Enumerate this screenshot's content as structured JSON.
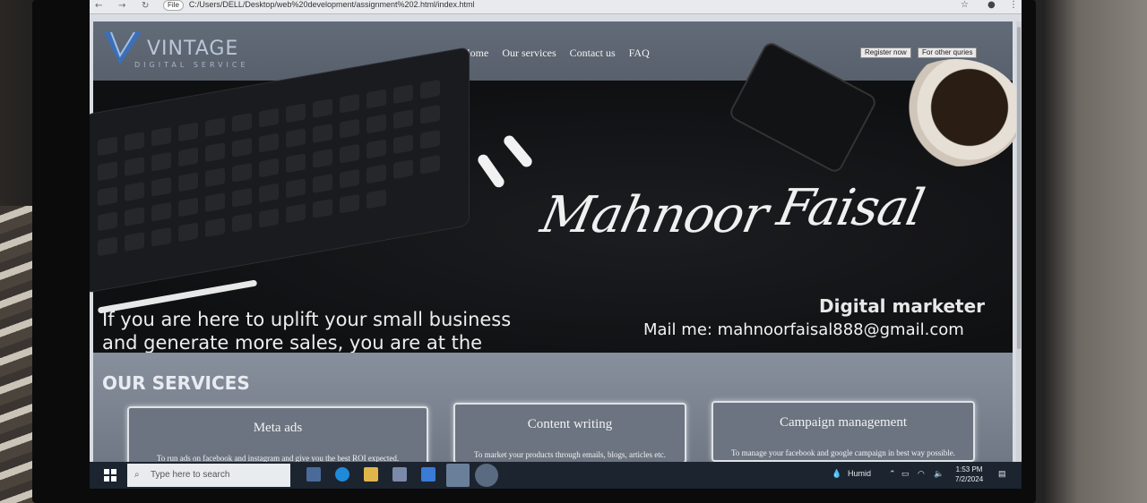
{
  "browser": {
    "url": "C:/Users/DELL/Desktop/web%20development/assignment%202.html/index.html",
    "protocol_label": "File"
  },
  "header": {
    "logo_word": "VINTAGE",
    "logo_sub": "DIGITAL SERVICE",
    "nav": [
      "Home",
      "Our services",
      "Contact us",
      "FAQ"
    ],
    "register_label": "Register now",
    "queries_label": "For other quries"
  },
  "hero": {
    "signature_first": "Mahnoor",
    "signature_last": "Faisal",
    "tagline": "If you are here to uplift your small business and generate more sales, you are at the right place!",
    "role": "Digital marketer",
    "mail": "Mail me: mahnoorfaisal888@gmail.com"
  },
  "services": {
    "title": "OUR SERVICES",
    "cards": [
      {
        "title": "Meta ads",
        "desc": "To run ads on facebook and instagram and give you the best ROI expected."
      },
      {
        "title": "Content writing",
        "desc": "To market your products through emails, blogs, articles etc."
      },
      {
        "title": "Campaign management",
        "desc": "To manage your facebook and google campaign in best way possible."
      }
    ]
  },
  "taskbar": {
    "search_placeholder": "Type here to search",
    "weather": "Humid",
    "time": "1:53 PM",
    "date": "7/2/2024"
  },
  "colors": {
    "header_bg": "#5e6672",
    "hero_bg": "#111214",
    "services_bg": "#7a838f",
    "taskbar_bg": "#1c2430"
  }
}
